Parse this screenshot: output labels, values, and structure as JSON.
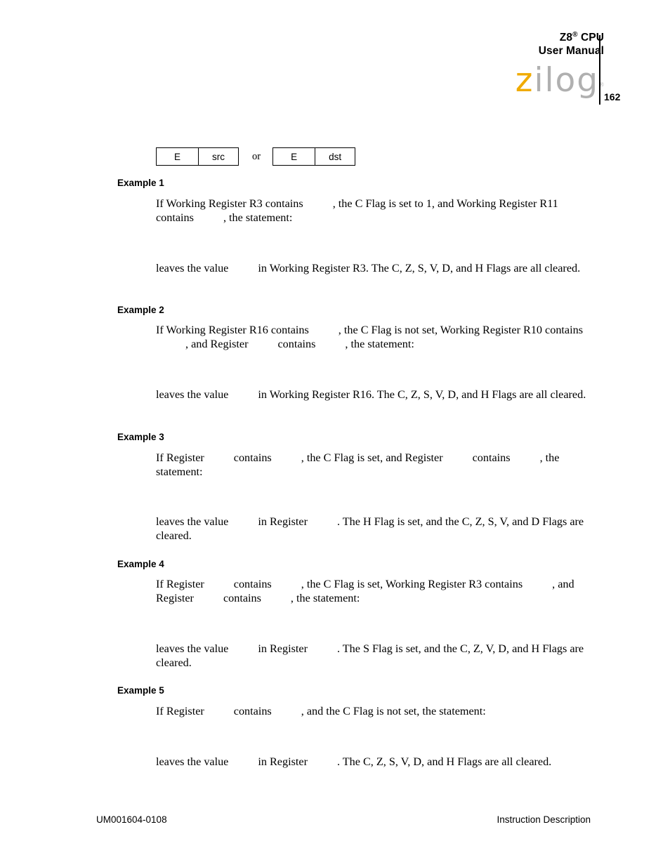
{
  "header": {
    "product": "Z8",
    "product_sup": "®",
    "product_suffix": " CPU",
    "manual_line": "User Manual",
    "logo_z": "z",
    "logo_ilog": "ilog",
    "logo_reg": "®",
    "page_number": "162",
    "brand_color_z": "#f0ab00",
    "brand_color_ilog": "#b0b0b0"
  },
  "opcode": {
    "left_box": {
      "cell1": "E",
      "cell2": "src"
    },
    "separator": "or",
    "right_box": {
      "cell1": "E",
      "cell2": "dst"
    }
  },
  "examples": [
    {
      "heading": "Example 1",
      "premise_segments": [
        "If Working Register R3 contains",
        ", the C Flag is set to 1, and Working Register R11 contains",
        ", the statement:"
      ],
      "result_segments": [
        "leaves the value",
        "in Working Register R3. The C, Z, S, V, D, and H Flags are all cleared."
      ]
    },
    {
      "heading": "Example 2",
      "premise_segments": [
        "If Working Register R16 contains",
        ", the C Flag is not set, Working Register R10 contains",
        ", and Register",
        "contains",
        ", the statement:"
      ],
      "result_segments": [
        "leaves the value",
        "in Working Register R16. The C, Z, S, V, D, and H Flags are all cleared."
      ]
    },
    {
      "heading": "Example 3",
      "premise_segments": [
        "If Register",
        "contains",
        ", the C Flag is set, and Register",
        "contains",
        ", the statement:"
      ],
      "result_segments": [
        "leaves the value",
        "in Register",
        ". The H Flag is set, and the C, Z, S, V, and D Flags are cleared."
      ]
    },
    {
      "heading": "Example 4",
      "premise_segments": [
        "If Register",
        "contains",
        ", the C Flag is set, Working Register R3 contains",
        ", and Register",
        "contains",
        ", the statement:"
      ],
      "result_segments": [
        "leaves the value",
        "in Register",
        ". The S Flag is set, and the C, Z, V, D, and H Flags are cleared."
      ]
    },
    {
      "heading": "Example 5",
      "premise_segments": [
        "If Register",
        "contains",
        ", and the C Flag is not set, the statement:"
      ],
      "result_segments": [
        "leaves the value",
        "in Register",
        ". The C, Z, S, V, D, and H Flags are all cleared."
      ]
    }
  ],
  "footer": {
    "document_number": "UM001604-0108",
    "section_title": "Instruction Description"
  }
}
